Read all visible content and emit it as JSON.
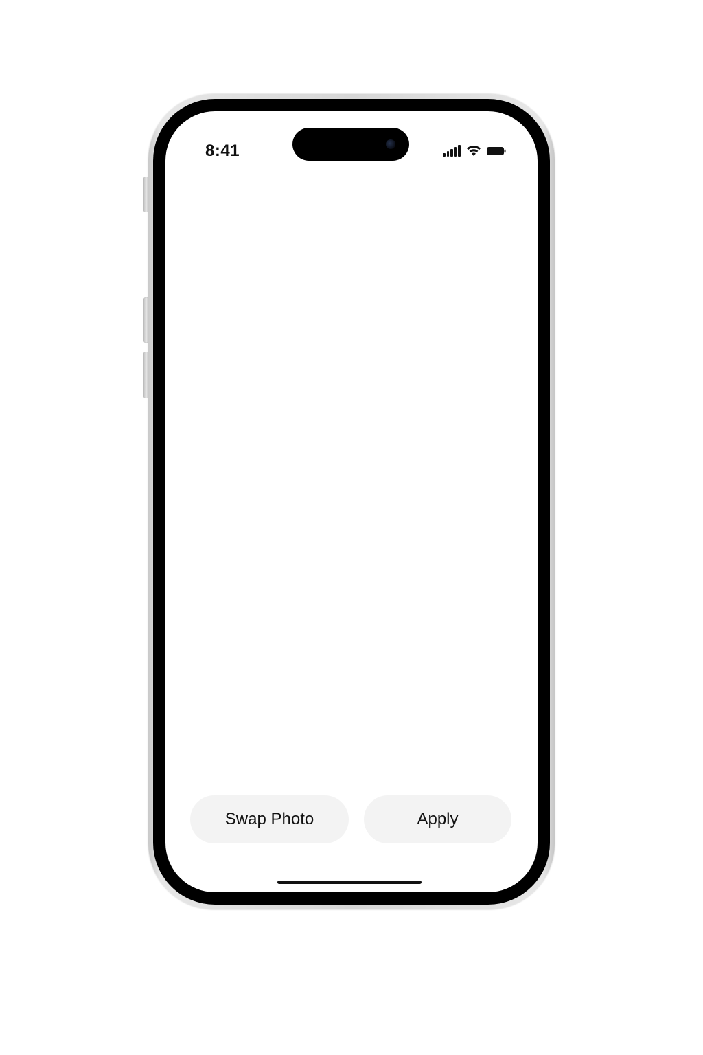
{
  "status_bar": {
    "time": "8:41",
    "icons": [
      "cellular-signal-icon",
      "wifi-icon",
      "battery-icon"
    ]
  },
  "actions": {
    "swap_photo_label": "Swap Photo",
    "apply_label": "Apply"
  },
  "colors": {
    "screen_background": "#ffffff",
    "button_background": "#f3f3f3",
    "text": "#111111",
    "bezel": "#000000",
    "frame": "#d6d6d6"
  }
}
